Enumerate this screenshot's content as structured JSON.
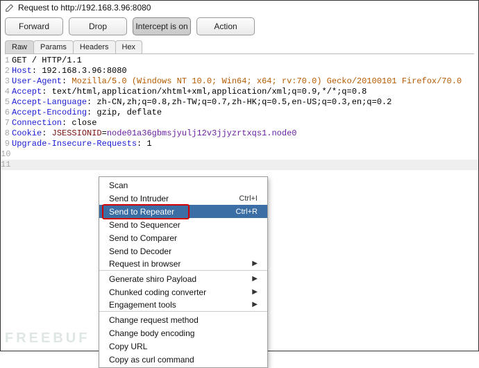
{
  "title": "Request to http://192.168.3.96:8080",
  "buttons": {
    "forward": "Forward",
    "drop": "Drop",
    "intercept": "Intercept is on",
    "action": "Action"
  },
  "tabs": [
    "Raw",
    "Params",
    "Headers",
    "Hex"
  ],
  "active_tab": 0,
  "lines": [
    {
      "n": "1",
      "segs": [
        {
          "t": "GET / HTTP/1.1",
          "c": ""
        }
      ]
    },
    {
      "n": "2",
      "segs": [
        {
          "t": "Host",
          "c": "hname"
        },
        {
          "t": ": 192.168.3.96:8080",
          "c": ""
        }
      ]
    },
    {
      "n": "3",
      "segs": [
        {
          "t": "User-Agent",
          "c": "hname"
        },
        {
          "t": ": ",
          "c": ""
        },
        {
          "t": "Mozilla/5.0 (Windows NT 10.0; Win64; x64; rv:70.0) Gecko/20100101 Firefox/70.0",
          "c": "orange"
        }
      ]
    },
    {
      "n": "4",
      "segs": [
        {
          "t": "Accept",
          "c": "hname"
        },
        {
          "t": ": text/html,application/xhtml+xml,application/xml;q=0.9,*/*;q=0.8",
          "c": ""
        }
      ]
    },
    {
      "n": "5",
      "segs": [
        {
          "t": "Accept-Language",
          "c": "hname"
        },
        {
          "t": ": zh-CN,zh;q=0.8,zh-TW;q=0.7,zh-HK;q=0.5,en-US;q=0.3,en;q=0.2",
          "c": ""
        }
      ]
    },
    {
      "n": "6",
      "segs": [
        {
          "t": "Accept-Encoding",
          "c": "hname"
        },
        {
          "t": ": gzip, deflate",
          "c": ""
        }
      ]
    },
    {
      "n": "7",
      "segs": [
        {
          "t": "Connection",
          "c": "hname"
        },
        {
          "t": ": close",
          "c": ""
        }
      ]
    },
    {
      "n": "8",
      "segs": [
        {
          "t": "Cookie",
          "c": "hname"
        },
        {
          "t": ": ",
          "c": ""
        },
        {
          "t": "JSESSIONID",
          "c": "m1"
        },
        {
          "t": "=",
          "c": ""
        },
        {
          "t": "node01a36gbmsjyulj12v3jjyzrtxqs1.node0",
          "c": "purple"
        }
      ]
    },
    {
      "n": "9",
      "segs": [
        {
          "t": "Upgrade-Insecure-Requests",
          "c": "hname"
        },
        {
          "t": ": 1",
          "c": ""
        }
      ]
    },
    {
      "n": "10",
      "segs": [
        {
          "t": "",
          "c": ""
        }
      ]
    },
    {
      "n": "11",
      "segs": [
        {
          "t": "",
          "c": ""
        }
      ],
      "hl": true
    }
  ],
  "context_menu": {
    "items": [
      {
        "label": "Scan",
        "shortcut": "",
        "submenu": false,
        "sep": false,
        "hl": false
      },
      {
        "label": "Send to Intruder",
        "shortcut": "Ctrl+I",
        "submenu": false,
        "sep": false,
        "hl": false
      },
      {
        "label": "Send to Repeater",
        "shortcut": "Ctrl+R",
        "submenu": false,
        "sep": false,
        "hl": true
      },
      {
        "label": "Send to Sequencer",
        "shortcut": "",
        "submenu": false,
        "sep": false,
        "hl": false
      },
      {
        "label": "Send to Comparer",
        "shortcut": "",
        "submenu": false,
        "sep": false,
        "hl": false
      },
      {
        "label": "Send to Decoder",
        "shortcut": "",
        "submenu": false,
        "sep": false,
        "hl": false
      },
      {
        "label": "Request in browser",
        "shortcut": "",
        "submenu": true,
        "sep": true,
        "hl": false
      },
      {
        "label": "Generate shiro Payload",
        "shortcut": "",
        "submenu": true,
        "sep": false,
        "hl": false
      },
      {
        "label": "Chunked coding converter",
        "shortcut": "",
        "submenu": true,
        "sep": false,
        "hl": false
      },
      {
        "label": "Engagement tools",
        "shortcut": "",
        "submenu": true,
        "sep": true,
        "hl": false
      },
      {
        "label": "Change request method",
        "shortcut": "",
        "submenu": false,
        "sep": false,
        "hl": false
      },
      {
        "label": "Change body encoding",
        "shortcut": "",
        "submenu": false,
        "sep": false,
        "hl": false
      },
      {
        "label": "Copy URL",
        "shortcut": "",
        "submenu": false,
        "sep": false,
        "hl": false
      },
      {
        "label": "Copy as curl command",
        "shortcut": "",
        "submenu": false,
        "sep": false,
        "hl": false
      }
    ]
  },
  "watermark": "FREEBUF"
}
